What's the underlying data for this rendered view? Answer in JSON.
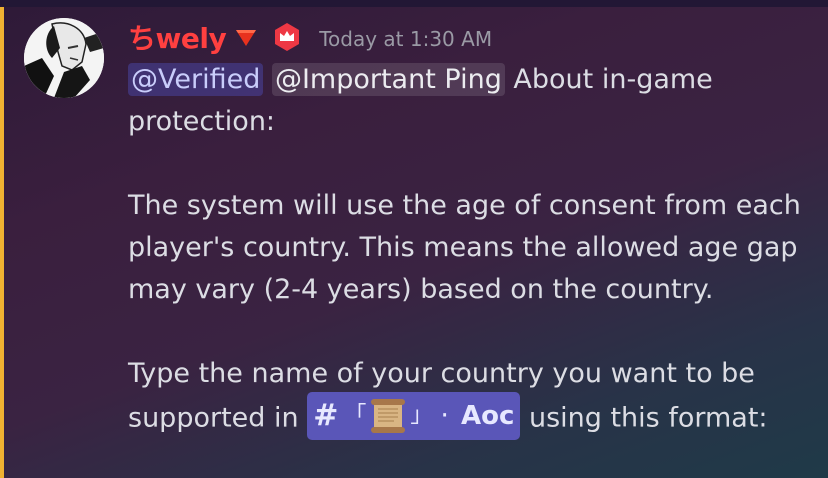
{
  "author": {
    "username": "ちwely",
    "timestamp": "Today at 1:30 AM"
  },
  "message": {
    "mention_1": "@Verified",
    "mention_2": "@Important Ping",
    "line1_rest": " About in-game protection:",
    "para2": "The system will use the age of consent from each player's country. This means the allowed age gap may vary (2-4 years) based on the country.",
    "para3_start": "Type the name of your country you want to be supported in ",
    "para3_end": " using this format:"
  },
  "channel": {
    "hash": "#",
    "open_bracket": "「",
    "close_bracket": "」",
    "separator": "·",
    "name": "Aoc",
    "icon": "scroll-icon"
  },
  "colors": {
    "highlight_bar": "#f0b232",
    "username": "#ff4040",
    "mention_bg": "#5865f2",
    "channel_pill": "#5a56b8"
  }
}
